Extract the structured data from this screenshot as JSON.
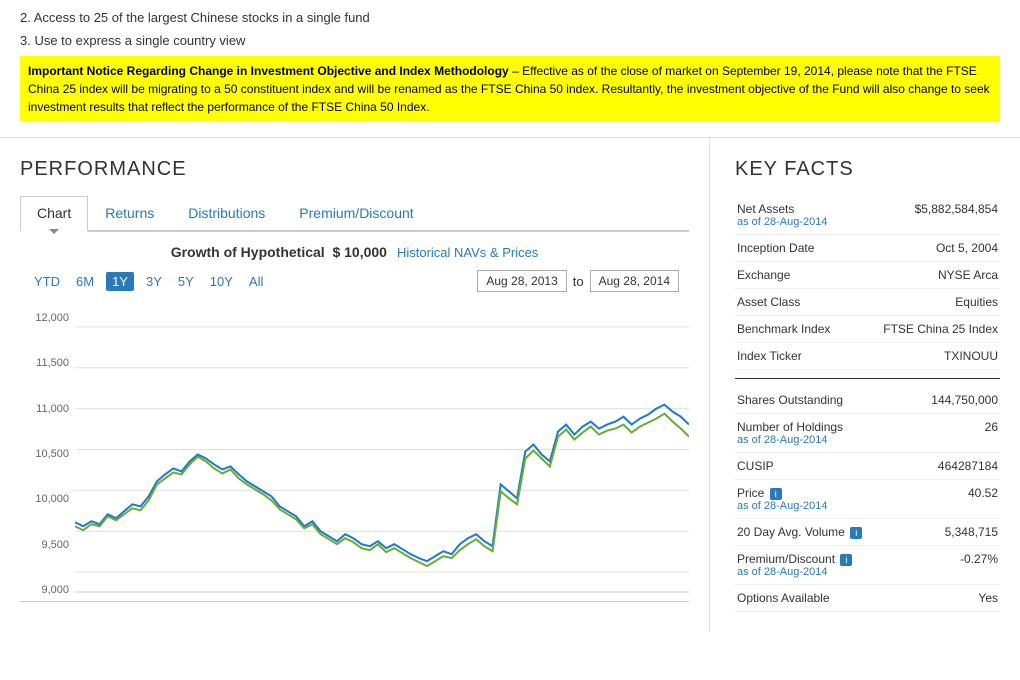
{
  "top": {
    "item2": "2. Access to 25 of the largest Chinese stocks in a single fund",
    "item3": "3. Use to express a single country view",
    "notice_bold": "Important Notice Regarding Change in Investment Objective and Index Methodology",
    "notice_text": " – Effective as of the close of market on September 19, 2014, please note that the FTSE China 25 index will be migrating to a 50 constituent index and will be renamed as the FTSE China 50 index. Resultantly, the investment objective of the Fund will also change to seek investment results that reflect the performance of the FTSE China 50 Index."
  },
  "performance": {
    "section_title": "PERFORMANCE",
    "tabs": [
      {
        "id": "chart",
        "label": "Chart",
        "active": true
      },
      {
        "id": "returns",
        "label": "Returns",
        "active": false
      },
      {
        "id": "distributions",
        "label": "Distributions",
        "active": false
      },
      {
        "id": "premium-discount",
        "label": "Premium/Discount",
        "active": false
      }
    ],
    "chart_title": "Growth of Hypothetical $ 10,000",
    "chart_link": "Historical NAVs & Prices",
    "time_buttons": [
      "YTD",
      "6M",
      "1Y",
      "3Y",
      "5Y",
      "10Y",
      "All"
    ],
    "active_time": "1Y",
    "date_from": "Aug 28, 2013",
    "date_to": "Aug 28, 2014",
    "date_sep": "to",
    "y_labels": [
      "12,000",
      "11,500",
      "11,000",
      "10,500",
      "10,000",
      "9,500",
      "9,000"
    ]
  },
  "key_facts": {
    "section_title": "KEY FACTS",
    "rows": [
      {
        "label": "Net Assets",
        "sub": "as of 28-Aug-2014",
        "value": "$5,882,584,854",
        "sub_val": ""
      },
      {
        "label": "Inception Date",
        "sub": "",
        "value": "Oct 5, 2004",
        "sub_val": ""
      },
      {
        "label": "Exchange",
        "sub": "",
        "value": "NYSE Arca",
        "sub_val": ""
      },
      {
        "label": "Asset Class",
        "sub": "",
        "value": "Equities",
        "sub_val": ""
      },
      {
        "label": "Benchmark Index",
        "sub": "",
        "value": "FTSE China 25 Index",
        "sub_val": ""
      },
      {
        "label": "Index Ticker",
        "sub": "",
        "value": "TXINOUU",
        "sub_val": ""
      }
    ],
    "separator": true,
    "rows2": [
      {
        "label": "Shares Outstanding",
        "sub": "",
        "value": "144,750,000",
        "sub_val": "",
        "info": false
      },
      {
        "label": "Number of Holdings",
        "sub": "as of 28-Aug-2014",
        "value": "26",
        "sub_val": "",
        "info": false
      },
      {
        "label": "CUSIP",
        "sub": "",
        "value": "464287184",
        "sub_val": "",
        "info": false
      },
      {
        "label": "Price",
        "sub": "as of 28-Aug-2014",
        "value": "40.52",
        "sub_val": "",
        "info": true
      },
      {
        "label": "20 Day Avg. Volume",
        "sub": "",
        "value": "5,348,715",
        "sub_val": "",
        "info": true
      },
      {
        "label": "Premium/Discount",
        "sub": "as of 28-Aug-2014",
        "value": "-0.27%",
        "sub_val": "",
        "info": true
      },
      {
        "label": "Options Available",
        "sub": "",
        "value": "Yes",
        "sub_val": "",
        "info": false
      }
    ]
  }
}
